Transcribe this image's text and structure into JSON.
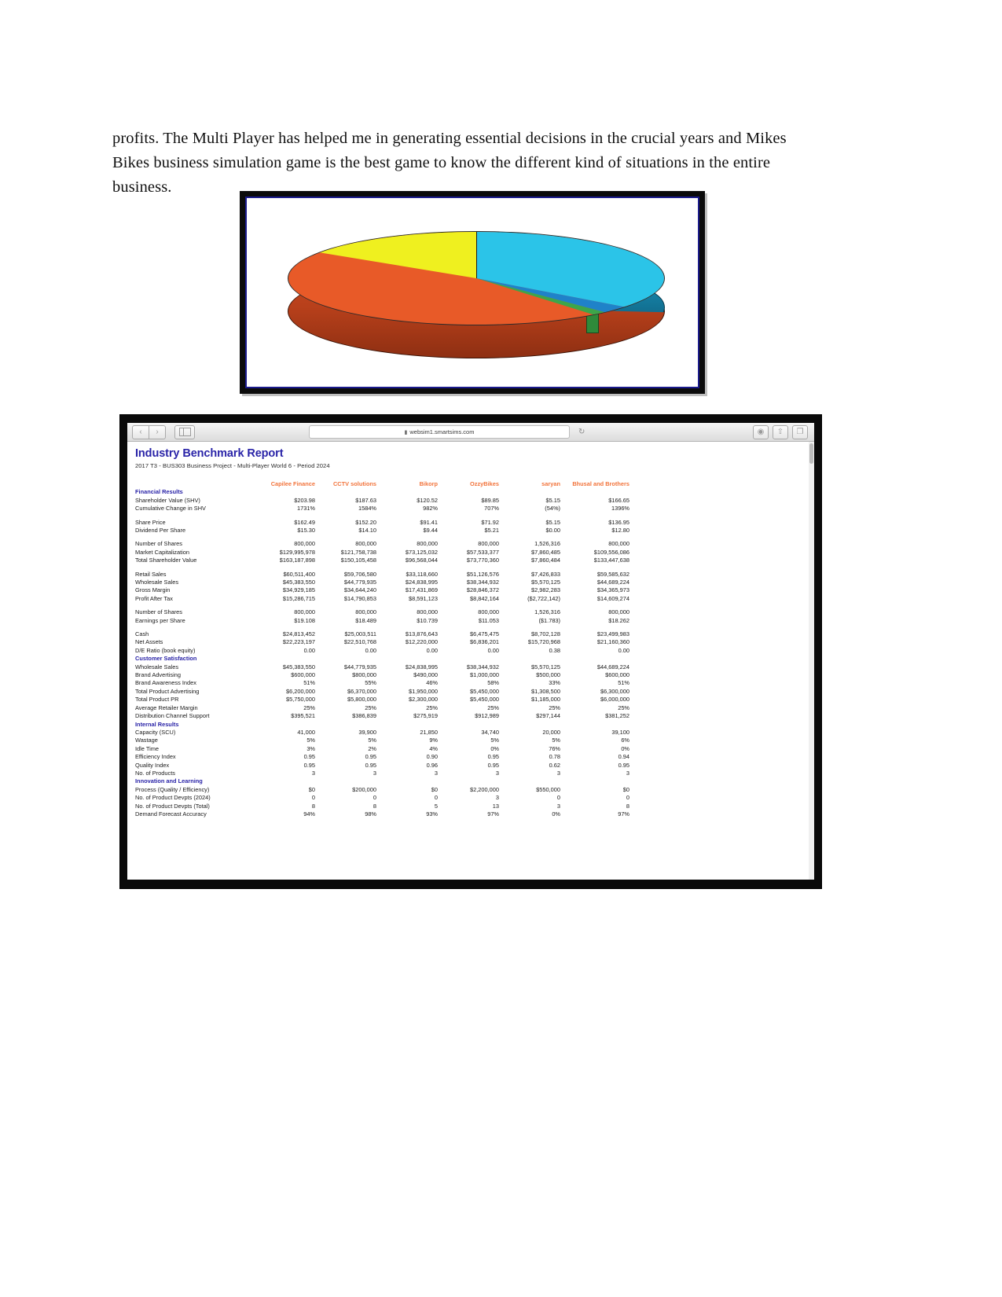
{
  "document": {
    "paragraph": "profits. The Multi Player has helped me in generating essential decisions in the crucial years and Mikes Bikes business simulation game is the best game to know the different kind of situations in the entire business."
  },
  "pie_figure": {
    "caption": ""
  },
  "browser": {
    "url": "websim1.smartsims.com",
    "lock_icon": "▮",
    "back_icon": "‹",
    "forward_icon": "›",
    "sidebar_icon": "sidebar-icon",
    "reload_icon": "↻",
    "share_icon": "⇧",
    "tabs_icon": "❐",
    "newtab_icon": "⊞"
  },
  "report": {
    "title": "Industry Benchmark Report",
    "subtitle": "2017 T3 - BUS303 Business Project - Multi-Player World 6 - Period 2024",
    "columns": [
      "Capilee Finance",
      "CCTV solutions",
      "Bikorp",
      "OzzyBikes",
      "saryan",
      "Bhusal and Brothers"
    ],
    "sections": [
      {
        "title": "Financial Results",
        "groups": [
          [
            {
              "label": "Shareholder Value (SHV)",
              "values": [
                "$203.98",
                "$187.63",
                "$120.52",
                "$89.85",
                "$5.15",
                "$166.65"
              ]
            },
            {
              "label": "Cumulative Change in SHV",
              "values": [
                "1731%",
                "1584%",
                "982%",
                "707%",
                "(54%)",
                "1396%"
              ]
            }
          ],
          [
            {
              "label": "Share Price",
              "values": [
                "$162.49",
                "$152.20",
                "$91.41",
                "$71.92",
                "$5.15",
                "$136.95"
              ]
            },
            {
              "label": "Dividend Per Share",
              "values": [
                "$15.30",
                "$14.10",
                "$9.44",
                "$5.21",
                "$0.00",
                "$12.80"
              ]
            }
          ],
          [
            {
              "label": "Number of Shares",
              "values": [
                "800,000",
                "800,000",
                "800,000",
                "800,000",
                "1,526,316",
                "800,000"
              ]
            },
            {
              "label": "Market Capitalization",
              "values": [
                "$129,995,978",
                "$121,758,738",
                "$73,125,032",
                "$57,533,377",
                "$7,860,485",
                "$109,556,086"
              ]
            },
            {
              "label": "Total Shareholder Value",
              "values": [
                "$163,187,898",
                "$150,105,458",
                "$96,568,044",
                "$73,770,360",
                "$7,860,484",
                "$133,447,638"
              ]
            }
          ],
          [
            {
              "label": "Retail Sales",
              "values": [
                "$60,511,400",
                "$59,706,580",
                "$33,118,660",
                "$51,126,576",
                "$7,426,833",
                "$59,585,632"
              ]
            },
            {
              "label": "Wholesale Sales",
              "values": [
                "$45,383,550",
                "$44,779,935",
                "$24,838,995",
                "$38,344,932",
                "$5,570,125",
                "$44,689,224"
              ]
            },
            {
              "label": "Gross Margin",
              "values": [
                "$34,929,185",
                "$34,644,240",
                "$17,431,869",
                "$28,846,372",
                "$2,982,283",
                "$34,365,973"
              ]
            },
            {
              "label": "Profit After Tax",
              "values": [
                "$15,286,715",
                "$14,790,853",
                "$8,591,123",
                "$8,842,164",
                "($2,722,142)",
                "$14,609,274"
              ]
            }
          ],
          [
            {
              "label": "Number of Shares",
              "values": [
                "800,000",
                "800,000",
                "800,000",
                "800,000",
                "1,526,316",
                "800,000"
              ]
            },
            {
              "label": "Earnings per Share",
              "values": [
                "$19.108",
                "$18.489",
                "$10.739",
                "$11.053",
                "($1.783)",
                "$18.262"
              ]
            }
          ],
          [
            {
              "label": "Cash",
              "values": [
                "$24,813,452",
                "$25,003,511",
                "$13,876,643",
                "$6,475,475",
                "$8,702,128",
                "$23,499,983"
              ]
            },
            {
              "label": "Net Assets",
              "values": [
                "$22,223,197",
                "$22,510,768",
                "$12,220,000",
                "$6,836,201",
                "$15,720,968",
                "$21,160,360"
              ]
            },
            {
              "label": "D/E Ratio (book equity)",
              "values": [
                "0.00",
                "0.00",
                "0.00",
                "0.00",
                "0.38",
                "0.00"
              ]
            }
          ]
        ]
      },
      {
        "title": "Customer Satisfaction",
        "groups": [
          [
            {
              "label": "Wholesale Sales",
              "values": [
                "$45,383,550",
                "$44,779,935",
                "$24,838,995",
                "$38,344,932",
                "$5,570,125",
                "$44,689,224"
              ]
            },
            {
              "label": "Brand Advertising",
              "values": [
                "$600,000",
                "$800,000",
                "$490,000",
                "$1,000,000",
                "$500,000",
                "$600,000"
              ]
            },
            {
              "label": "Brand Awareness Index",
              "values": [
                "51%",
                "55%",
                "46%",
                "58%",
                "33%",
                "51%"
              ]
            },
            {
              "label": "Total Product Advertising",
              "values": [
                "$6,200,000",
                "$6,370,000",
                "$1,950,000",
                "$5,450,000",
                "$1,308,500",
                "$6,300,000"
              ]
            },
            {
              "label": "Total Product PR",
              "values": [
                "$5,750,000",
                "$5,800,000",
                "$2,300,000",
                "$5,450,000",
                "$1,185,000",
                "$6,000,000"
              ]
            },
            {
              "label": "Average Retailer Margin",
              "values": [
                "25%",
                "25%",
                "25%",
                "25%",
                "25%",
                "25%"
              ]
            },
            {
              "label": "Distribution Channel Support",
              "values": [
                "$395,521",
                "$386,839",
                "$275,919",
                "$912,989",
                "$297,144",
                "$381,252"
              ]
            }
          ]
        ]
      },
      {
        "title": "Internal Results",
        "groups": [
          [
            {
              "label": "Capacity (SCU)",
              "values": [
                "41,000",
                "39,900",
                "21,850",
                "34,740",
                "20,000",
                "39,100"
              ]
            },
            {
              "label": "Wastage",
              "values": [
                "5%",
                "5%",
                "9%",
                "5%",
                "5%",
                "6%"
              ]
            },
            {
              "label": "Idle Time",
              "values": [
                "3%",
                "2%",
                "4%",
                "0%",
                "76%",
                "0%"
              ]
            },
            {
              "label": "Efficiency Index",
              "values": [
                "0.95",
                "0.95",
                "0.90",
                "0.95",
                "0.78",
                "0.94"
              ]
            },
            {
              "label": "Quality Index",
              "values": [
                "0.95",
                "0.95",
                "0.96",
                "0.95",
                "0.62",
                "0.95"
              ]
            },
            {
              "label": "No. of Products",
              "values": [
                "3",
                "3",
                "3",
                "3",
                "3",
                "3"
              ]
            }
          ]
        ]
      },
      {
        "title": "Innovation and Learning",
        "groups": [
          [
            {
              "label": "Process (Quality / Efficiency)",
              "values": [
                "$0",
                "$200,000",
                "$0",
                "$2,200,000",
                "$550,000",
                "$0"
              ]
            },
            {
              "label": "No. of Product Devpts (2024)",
              "values": [
                "0",
                "0",
                "0",
                "3",
                "0",
                "0"
              ]
            },
            {
              "label": "No. of Product Devpts (Total)",
              "values": [
                "8",
                "8",
                "5",
                "13",
                "3",
                "8"
              ]
            },
            {
              "label": "Demand Forecast Accuracy",
              "values": [
                "94%",
                "98%",
                "93%",
                "97%",
                "0%",
                "97%"
              ]
            }
          ]
        ]
      }
    ]
  },
  "chart_data": {
    "type": "pie",
    "title": "",
    "labels": [
      "Segment A (orange)",
      "Segment B (cyan)",
      "Segment C (yellow)",
      "Segment D (blue)",
      "Segment E (green)"
    ],
    "values": [
      46,
      26,
      25,
      2,
      1
    ],
    "colors": [
      "#e85a28",
      "#2bc4e8",
      "#eff01f",
      "#1f82c9",
      "#3da64a"
    ],
    "legend": "none",
    "three_d": true
  }
}
